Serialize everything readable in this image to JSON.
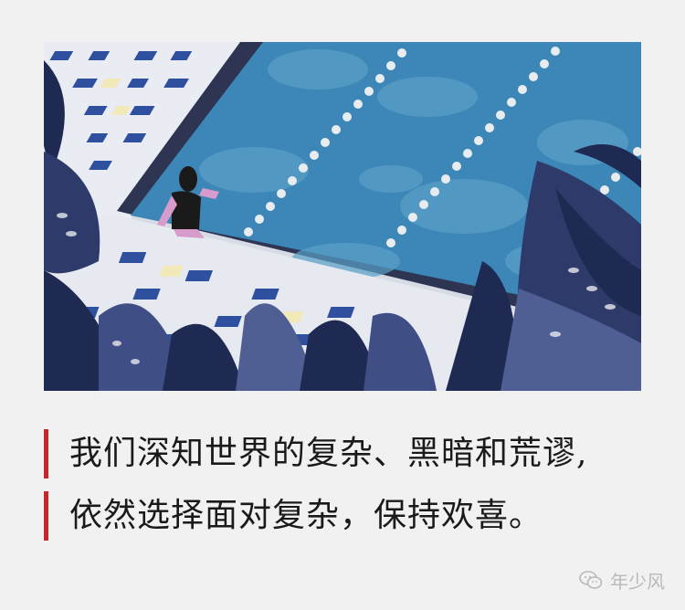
{
  "quote": {
    "line1": "我们深知世界的复杂、黑暗和荒谬,",
    "line2": "依然选择面对复杂，保持欢喜。"
  },
  "watermark": {
    "account_name": "年少风",
    "icon": "wechat-icon"
  },
  "illustration": {
    "description_icon": "pool-illustration",
    "colors": {
      "water": "#3d86b8",
      "water_light": "#5aa0c8",
      "deck": "#2d3553",
      "tile_blue": "#2f4f9f",
      "tile_white": "#eef0f4",
      "leaf_dark": "#1f2a52",
      "leaf_mid": "#4f5f94",
      "swimsuit": "#1a1a1a",
      "skin": "#d89ccc"
    }
  },
  "accent_color": "#c8262b"
}
